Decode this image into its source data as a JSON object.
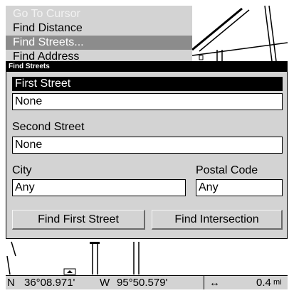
{
  "menu": {
    "items": [
      {
        "label": "Go To Cursor",
        "state": "disabled"
      },
      {
        "label": "Find Distance",
        "state": "normal"
      },
      {
        "label": "Find Streets...",
        "state": "selected"
      },
      {
        "label": "Find Address",
        "state": "normal"
      }
    ]
  },
  "dialog": {
    "title": "Find Streets",
    "first_street": {
      "label": "First Street",
      "value": "None"
    },
    "second_street": {
      "label": "Second Street",
      "value": "None"
    },
    "city": {
      "label": "City",
      "value": "Any"
    },
    "postal_code": {
      "label": "Postal Code",
      "value": "Any"
    },
    "buttons": {
      "find_first": "Find First Street",
      "find_intersection": "Find Intersection"
    }
  },
  "status": {
    "lat_hemisphere": "N",
    "lat": "36°08.971'",
    "lon_hemisphere": "W",
    "lon": "95°50.579'",
    "distance_icon": "double-arrow-icon",
    "distance": "0.4",
    "distance_unit": "mi"
  }
}
